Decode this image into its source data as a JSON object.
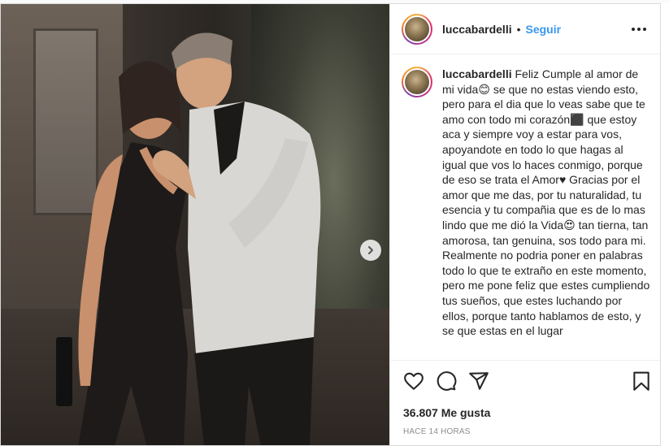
{
  "post": {
    "username": "luccabardelli",
    "separator": "•",
    "follow_label": "Seguir",
    "more_icon": "more-options-icon",
    "caption": {
      "username": "luccabardelli",
      "text": "Feliz Cumple al amor de mi vida😊 se que no estas viendo esto, pero para el dia que lo veas sabe que te amo con todo mi corazón⬛ que estoy aca y siempre voy a estar para vos, apoyandote en todo lo que hagas al igual que vos lo haces conmigo, porque de eso se trata el Amor♥ Gracias por el amor que me das, por tu naturalidad, tu esencia y tu compañia que es de lo mas lindo que me dió la Vida😍 tan tierna, tan amorosa, tan genuina, sos todo para mi. Realmente no podria poner en palabras todo lo que te extraño en este momento, pero me pone feliz que estes cumpliendo tus sueños, que estes luchando por ellos, porque tanto hablamos de esto, y se que estas en el lugar"
    },
    "likes": "36.807 Me gusta",
    "timestamp": "HACE 14 HORAS",
    "icons": {
      "like": "heart-icon",
      "comment": "comment-icon",
      "share": "share-icon",
      "save": "bookmark-icon",
      "next": "chevron-right-icon"
    },
    "colors": {
      "follow": "#3897f0",
      "text": "#262626",
      "muted": "#8e8e8e",
      "border": "#dbdbdb"
    }
  }
}
